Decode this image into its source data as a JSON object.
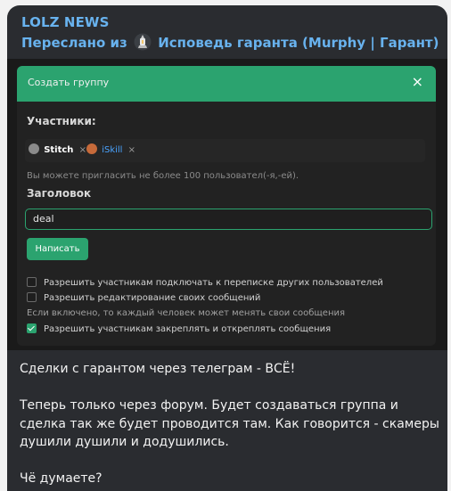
{
  "message": {
    "sender": "LOLZ NEWS",
    "forwarded_prefix": "Переслано из",
    "forwarded_source": "Исповедь гаранта (Murphy | Гарант)",
    "paragraphs": [
      "Сделки с гарантом через телеграм - ВСЁ!",
      "Теперь только через форум. Будет создаваться группа и сделка так же будет проводится там. Как говорится - скамеры душили душили и додушились.",
      "Чё думаете?"
    ]
  },
  "screenshot": {
    "modal_title": "Создать группу",
    "close_symbol": "×",
    "participants_label": "Участники:",
    "participants": [
      {
        "name": "Stitch",
        "color": "#ffffff",
        "avatar": "#8a8a8a"
      },
      {
        "name": "iSkill",
        "color": "#4aa3ff",
        "avatar": "#c66a3a"
      }
    ],
    "remove_symbol": "×",
    "invite_hint": "Вы можете пригласить не более 100 пользовател(-я,-ей).",
    "title_label": "Заголовок",
    "title_value": "deal",
    "submit_label": "Написать",
    "options": [
      {
        "label": "Разрешить участникам подключать к переписке других пользователей",
        "checked": false
      },
      {
        "label": "Разрешить редактирование своих сообщений",
        "checked": false
      }
    ],
    "edit_hint": "Если включено, то каждый человек может менять свои сообщения",
    "pin_option": {
      "label": "Разрешить участникам закреплять и откреплять сообщения",
      "checked": true
    }
  },
  "colors": {
    "accent": "#2ba36f",
    "link": "#68b2ee",
    "bubble": "#2a2c30"
  }
}
